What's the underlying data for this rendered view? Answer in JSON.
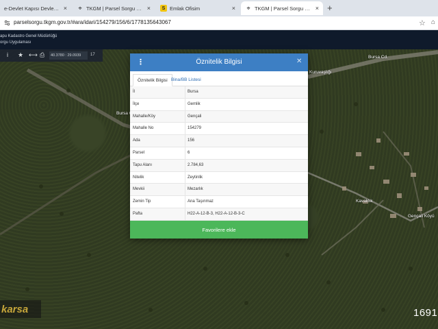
{
  "browser": {
    "tabs": [
      {
        "title": "e-Devlet Kapısı Devletin Kısa",
        "icon": "globe-icon",
        "active": false
      },
      {
        "title": "TKGM | Parsel Sorgu Uygulan",
        "icon": "map-pin-icon",
        "active": false
      },
      {
        "title": "Emlak Ofisim",
        "icon": "s-logo-icon",
        "active": false
      },
      {
        "title": "TKGM | Parsel Sorgu Uygulan",
        "icon": "map-pin-icon",
        "active": true
      }
    ],
    "new_tab": "+",
    "url": "parselsorgu.tkgm.gov.tr/#ara/idari/154279/156/6/1778135643067"
  },
  "site": {
    "line1": "apu Kadastro Genel Müdürlüğü",
    "line2": "orgu Uygulaması"
  },
  "map": {
    "toolbar": {
      "info": "i",
      "star": "★",
      "measure": "⟷",
      "print": "⎙",
      "coords": "40.3780 : 29.0939",
      "zoom": "17"
    },
    "labels": {
      "road1": "Bursa Cd.",
      "road2": "Bursa Cd.",
      "village": "Gençali Köyü",
      "street1": "Kavaklık",
      "street2": "Kuruvaşlığı"
    },
    "brand": "karsa",
    "counter": "1691"
  },
  "dialog": {
    "title": "Öznitelik Bilgisi",
    "tabs": [
      "Öznitelik Bilgisi",
      "Bina/BB Listesi"
    ],
    "rows": [
      {
        "key": "İl",
        "value": "Bursa"
      },
      {
        "key": "İlçe",
        "value": "Gemlik"
      },
      {
        "key": "Mahalle/Köy",
        "value": "Gençali"
      },
      {
        "key": "Mahalle No",
        "value": "154279"
      },
      {
        "key": "Ada",
        "value": "156"
      },
      {
        "key": "Parsel",
        "value": "6"
      },
      {
        "key": "Tapu Alanı",
        "value": "2.784,63"
      },
      {
        "key": "Nitelik",
        "value": "Zeytinlik"
      },
      {
        "key": "Mevkii",
        "value": "Mezarlık"
      },
      {
        "key": "Zemin Tip",
        "value": "Ana Taşınmaz"
      },
      {
        "key": "Pafta",
        "value": "H22-A-12-B-3, H22-A-12-B-3-C"
      }
    ],
    "button": "Favorilere ekle"
  },
  "colors": {
    "dialog_header": "#3d7fc4",
    "favorites_button": "#4cb75a",
    "site_header": "#0f1a2b"
  }
}
